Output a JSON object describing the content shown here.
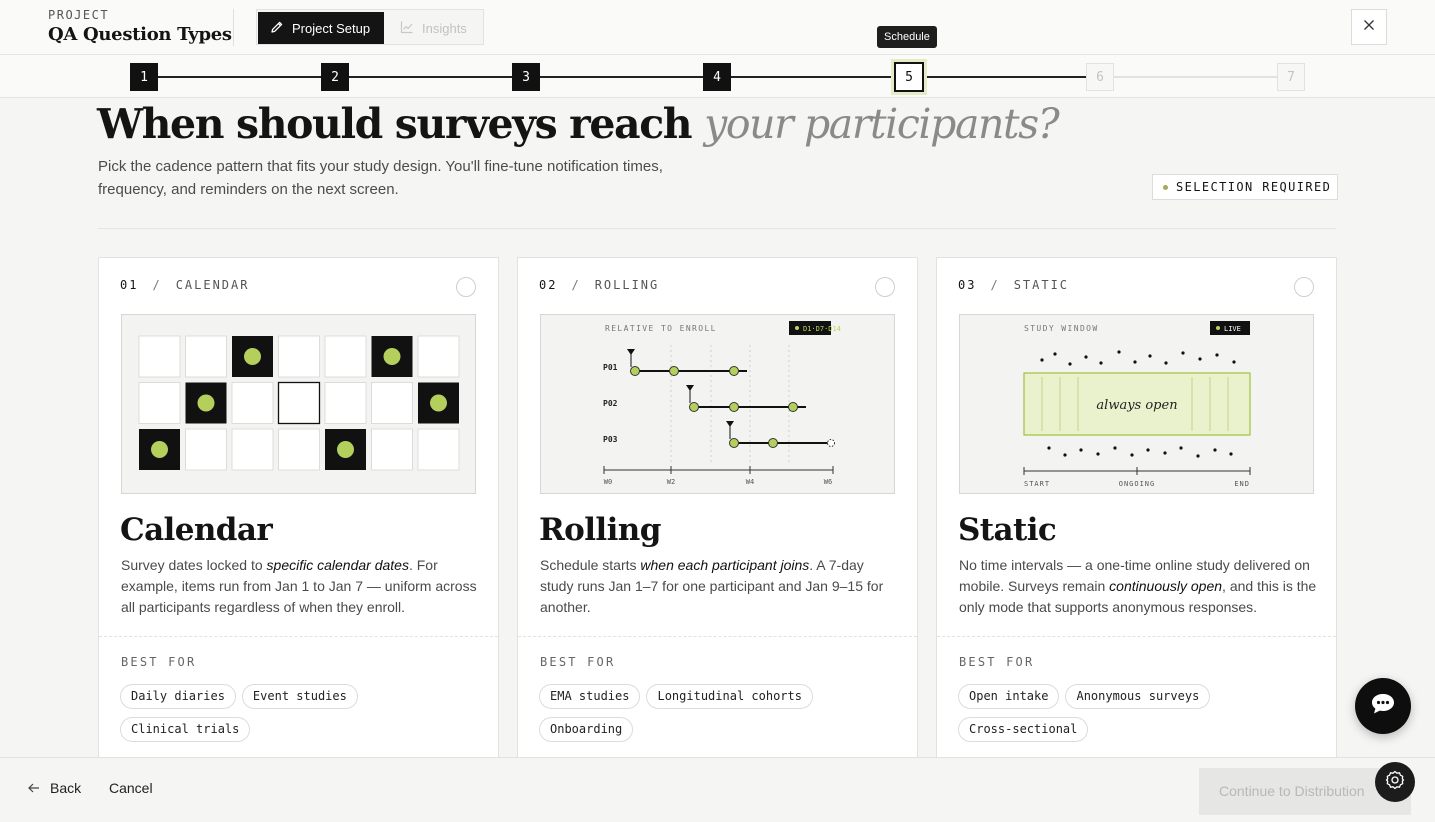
{
  "header": {
    "project_label": "PROJECT",
    "project_title": "QA Question Types",
    "tabs": [
      {
        "label": "Project Setup",
        "icon": "pencil-icon",
        "active": true
      },
      {
        "label": "Insights",
        "icon": "chart-icon",
        "active": false
      }
    ],
    "tooltip": "Schedule",
    "close_icon": "close-icon"
  },
  "stepper": {
    "steps": [
      {
        "label": "1",
        "state": "done"
      },
      {
        "label": "2",
        "state": "done"
      },
      {
        "label": "3",
        "state": "done"
      },
      {
        "label": "4",
        "state": "done"
      },
      {
        "label": "5",
        "state": "current"
      },
      {
        "label": "6",
        "state": "todo"
      },
      {
        "label": "7",
        "state": "todo"
      }
    ]
  },
  "hero": {
    "title_main": "When should surveys reach",
    "title_em": "your participants?",
    "description": "Pick the cadence pattern that fits your study design. You'll fine-tune notification times, frequency, and reminders on the next screen.",
    "badge": "SELECTION REQUIRED"
  },
  "cards": [
    {
      "num": "01",
      "category": "CALENDAR",
      "title": "Calendar",
      "desc_before": "Survey dates locked to ",
      "desc_em": "specific calendar dates",
      "desc_after": ". For example, items run from Jan 1 to Jan 7 — uniform across all participants regardless of when they enroll.",
      "best_for_label": "BEST FOR",
      "tags": [
        "Daily diaries",
        "Event studies",
        "Clinical trials"
      ]
    },
    {
      "num": "02",
      "category": "ROLLING",
      "title": "Rolling",
      "desc_before": "Schedule starts ",
      "desc_em": "when each participant joins",
      "desc_after": ". A 7-day study runs Jan 1–7 for one participant and Jan 9–15 for another.",
      "best_for_label": "BEST FOR",
      "tags": [
        "EMA studies",
        "Longitudinal cohorts",
        "Onboarding"
      ],
      "illustration": {
        "caption": "RELATIVE TO ENROLL",
        "badge": "D1·D7·D14",
        "rows": [
          "P01",
          "P02",
          "P03"
        ],
        "ticks": [
          "W0",
          "W2",
          "W4",
          "W6"
        ]
      }
    },
    {
      "num": "03",
      "category": "STATIC",
      "title": "Static",
      "desc_before": "No time intervals — a one-time online study delivered on mobile. Surveys remain ",
      "desc_em": "continuously open",
      "desc_after": ", and this is the only mode that supports anonymous responses.",
      "best_for_label": "BEST FOR",
      "tags": [
        "Open intake",
        "Anonymous surveys",
        "Cross-sectional"
      ],
      "illustration": {
        "caption": "STUDY WINDOW",
        "badge": "LIVE",
        "center_label": "always open",
        "ticks": [
          "START",
          "ONGOING",
          "END"
        ]
      }
    }
  ],
  "footer": {
    "back_label": "Back",
    "cancel_label": "Cancel",
    "continue_label": "Continue to Distribution"
  },
  "colors": {
    "accent_green": "#b5cf5c",
    "dark": "#111111",
    "live_green": "#b9d65a"
  }
}
